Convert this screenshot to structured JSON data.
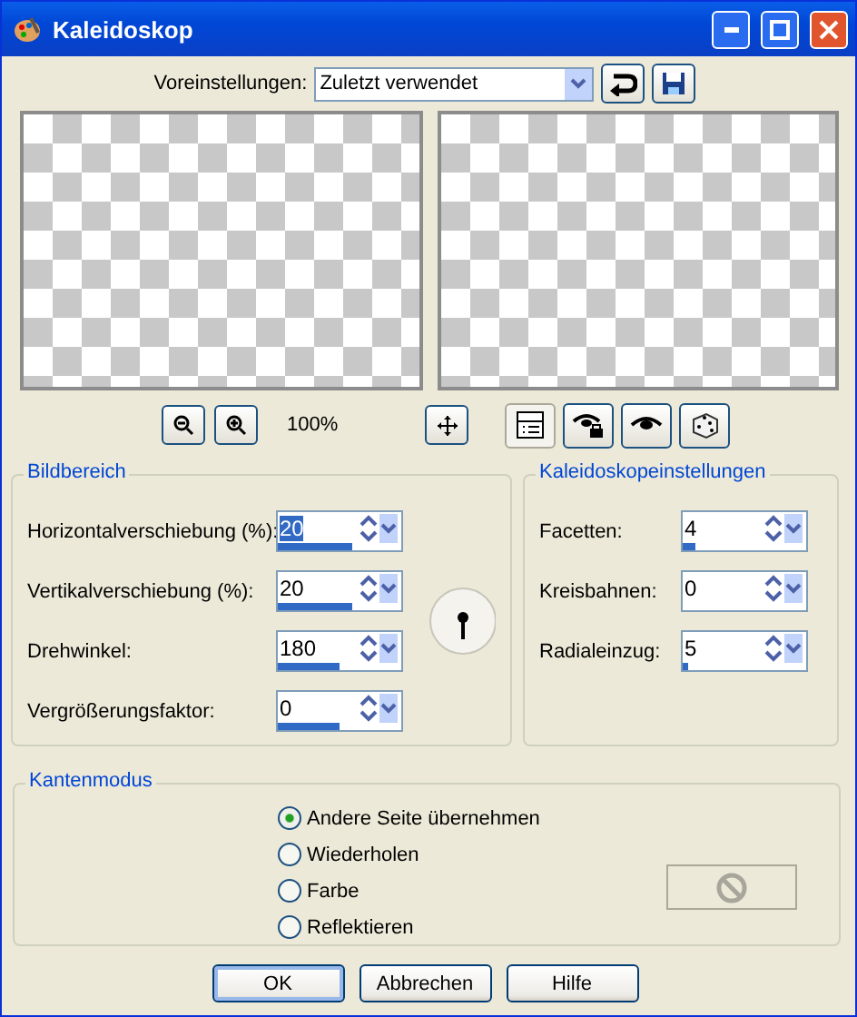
{
  "window": {
    "title": "Kaleidoskop"
  },
  "presets": {
    "label": "Voreinstellungen:",
    "value": "Zuletzt verwendet"
  },
  "zoom": {
    "reading": "100%"
  },
  "toolbar_toggles": [
    {
      "kind": "layout",
      "selected": true
    },
    {
      "kind": "eye-lock",
      "selected": false
    },
    {
      "kind": "eye",
      "selected": false
    },
    {
      "kind": "dice",
      "selected": false
    }
  ],
  "image_area": {
    "title": "Bildbereich",
    "fields": [
      {
        "label": "Horizontalverschiebung (%):",
        "value": "20",
        "level": 0.6,
        "selected": true
      },
      {
        "label": "Vertikalverschiebung (%):",
        "value": "20",
        "level": 0.6,
        "selected": false
      },
      {
        "label": "Drehwinkel:",
        "value": "180",
        "level": 0.5,
        "selected": false
      },
      {
        "label": "Vergrößerungsfaktor:",
        "value": "0",
        "level": 0.5,
        "selected": false
      }
    ]
  },
  "kaleidoscope_settings": {
    "title": "Kaleidoskopeinstellungen",
    "fields": [
      {
        "label": "Facetten:",
        "value": "4",
        "level": 0.1,
        "selected": false
      },
      {
        "label": "Kreisbahnen:",
        "value": "0",
        "selected": false
      },
      {
        "label": "Radialeinzug:",
        "value": "5",
        "level": 0.04,
        "selected": false
      }
    ]
  },
  "edge_mode": {
    "title": "Kantenmodus",
    "options": [
      {
        "label": "Andere Seite übernehmen",
        "selected": true
      },
      {
        "label": "Wiederholen",
        "selected": false
      },
      {
        "label": "Farbe",
        "selected": false
      },
      {
        "label": "Reflektieren",
        "selected": false
      }
    ],
    "color_disabled": true
  },
  "buttons": [
    {
      "label": "OK",
      "default": true
    },
    {
      "label": "Abbrechen",
      "default": false
    },
    {
      "label": "Hilfe",
      "default": false
    }
  ]
}
